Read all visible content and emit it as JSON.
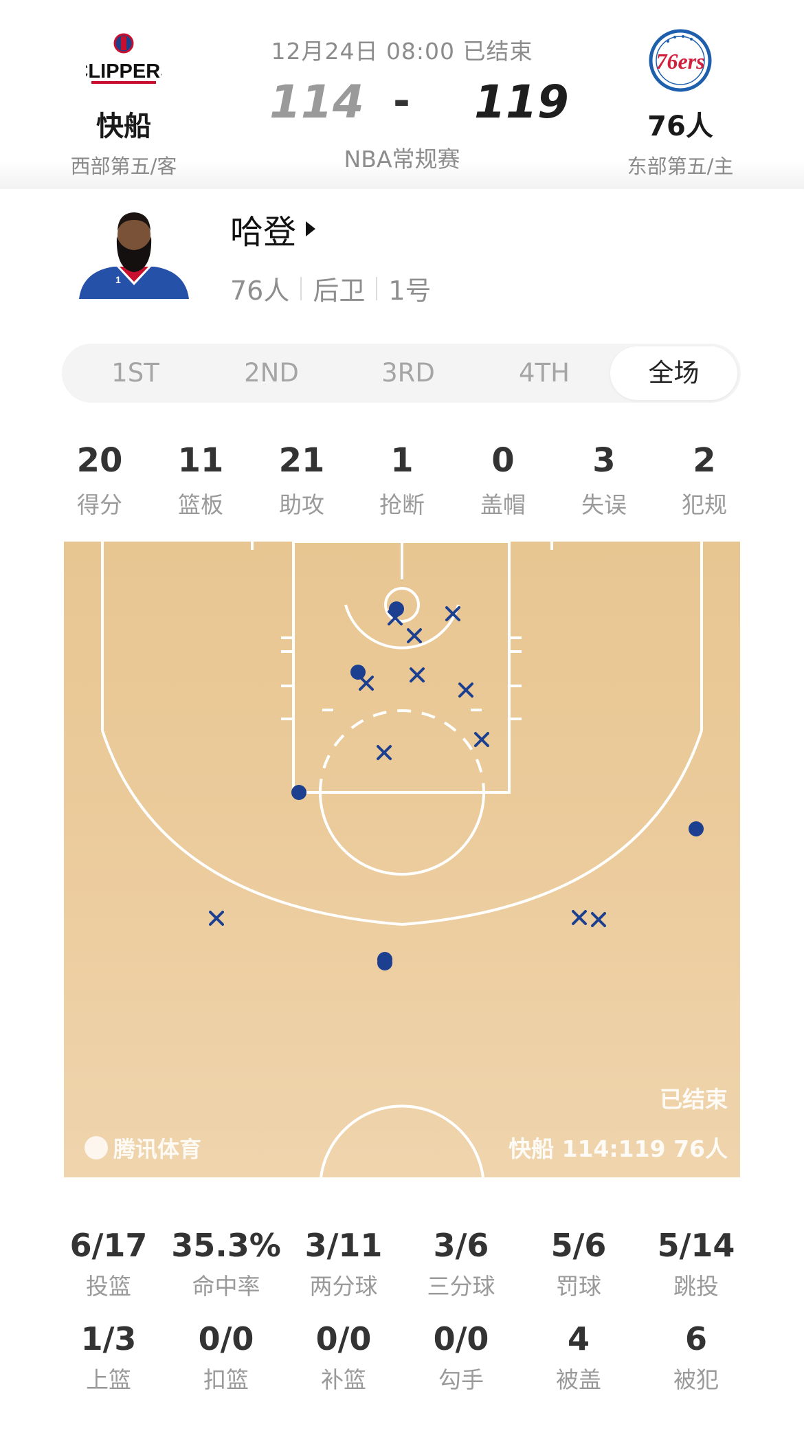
{
  "game": {
    "date_status": "12月24日 08:00 已结束",
    "away": {
      "name": "快船",
      "rank": "西部第五/客",
      "score": "114",
      "logo_text": "CLIPPERS",
      "logo_icon": "clippers-logo-icon"
    },
    "home": {
      "name": "76人",
      "rank": "东部第五/主",
      "score": "119",
      "logo_text": "76ers",
      "logo_icon": "76ers-logo-icon"
    },
    "dash": "-",
    "type": "NBA常规赛"
  },
  "player": {
    "name": "哈登",
    "team": "76人",
    "position": "后卫",
    "number": "1号",
    "jersey_number": "1"
  },
  "tabs": [
    {
      "label": "1ST",
      "active": false
    },
    {
      "label": "2ND",
      "active": false
    },
    {
      "label": "3RD",
      "active": false
    },
    {
      "label": "4TH",
      "active": false
    },
    {
      "label": "全场",
      "active": true
    }
  ],
  "stats": [
    {
      "value": "20",
      "label": "得分"
    },
    {
      "value": "11",
      "label": "篮板"
    },
    {
      "value": "21",
      "label": "助攻"
    },
    {
      "value": "1",
      "label": "抢断"
    },
    {
      "value": "0",
      "label": "盖帽"
    },
    {
      "value": "3",
      "label": "失误"
    },
    {
      "value": "2",
      "label": "犯规"
    }
  ],
  "court": {
    "brand": "腾讯体育",
    "status": "已结束",
    "score_line": "快船 114:119 76人",
    "colors": {
      "made": "#1d3f8f",
      "missed": "#1d3f8f",
      "lines": "#ffffff"
    }
  },
  "shooting": [
    [
      {
        "value": "6/17",
        "label": "投篮"
      },
      {
        "value": "35.3%",
        "label": "命中率"
      },
      {
        "value": "3/11",
        "label": "两分球"
      },
      {
        "value": "3/6",
        "label": "三分球"
      },
      {
        "value": "5/6",
        "label": "罚球"
      },
      {
        "value": "5/14",
        "label": "跳投"
      }
    ],
    [
      {
        "value": "1/3",
        "label": "上篮"
      },
      {
        "value": "0/0",
        "label": "扣篮"
      },
      {
        "value": "0/0",
        "label": "补篮"
      },
      {
        "value": "0/0",
        "label": "勾手"
      },
      {
        "value": "4",
        "label": "被盖"
      },
      {
        "value": "6",
        "label": "被犯"
      }
    ]
  ]
}
